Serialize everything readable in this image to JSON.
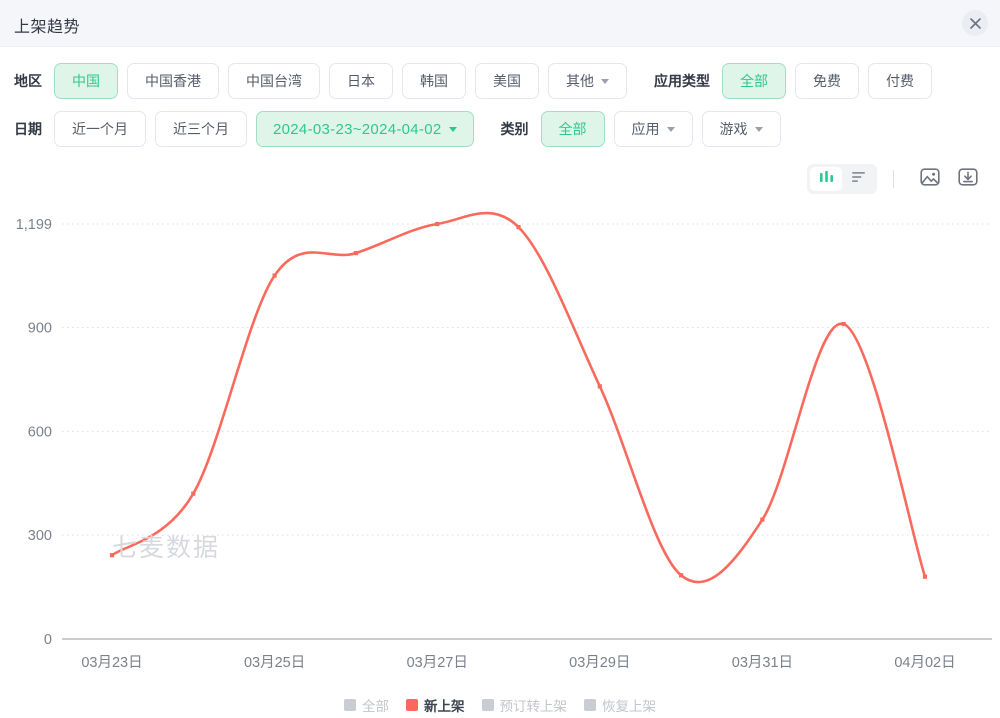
{
  "header": {
    "title": "上架趋势",
    "close_icon": "close-icon"
  },
  "filters": {
    "region": {
      "label": "地区",
      "options": [
        {
          "label": "中国",
          "active": true,
          "caret": false
        },
        {
          "label": "中国香港",
          "active": false,
          "caret": false
        },
        {
          "label": "中国台湾",
          "active": false,
          "caret": false
        },
        {
          "label": "日本",
          "active": false,
          "caret": false
        },
        {
          "label": "韩国",
          "active": false,
          "caret": false
        },
        {
          "label": "美国",
          "active": false,
          "caret": false
        },
        {
          "label": "其他",
          "active": false,
          "caret": true
        }
      ]
    },
    "app_type": {
      "label": "应用类型",
      "options": [
        {
          "label": "全部",
          "active": true,
          "caret": false
        },
        {
          "label": "免费",
          "active": false,
          "caret": false
        },
        {
          "label": "付费",
          "active": false,
          "caret": false
        }
      ]
    },
    "date": {
      "label": "日期",
      "options": [
        {
          "label": "近一个月",
          "active": false,
          "caret": false
        },
        {
          "label": "近三个月",
          "active": false,
          "caret": false
        },
        {
          "label": "2024-03-23~2024-04-02",
          "active": true,
          "caret": true
        }
      ]
    },
    "category": {
      "label": "类别",
      "options": [
        {
          "label": "全部",
          "active": true,
          "caret": false
        },
        {
          "label": "应用",
          "active": false,
          "caret": true
        },
        {
          "label": "游戏",
          "active": false,
          "caret": true
        }
      ]
    }
  },
  "toolbar": {
    "chart_view_icon": "bar-chart-icon",
    "table_view_icon": "list-view-icon",
    "image_export_icon": "image-export-icon",
    "download_icon": "download-icon",
    "selected_view": "chart"
  },
  "chart": {
    "watermark": "七麦数据",
    "accent_color": "#f96a5d",
    "grid_color": "#dcdee3",
    "axis_color": "#b8bcc6",
    "tick_label_color": "#7b818c"
  },
  "chart_data": {
    "type": "line",
    "title": "上架趋势",
    "xlabel": "",
    "ylabel": "",
    "grid": true,
    "legend_position": "bottom",
    "ylim": [
      0,
      1199
    ],
    "yticks": [
      0,
      300,
      600,
      900,
      1199
    ],
    "ytick_labels": [
      "0",
      "300",
      "600",
      "900",
      "1,199"
    ],
    "x": [
      "03月23日",
      "03月24日",
      "03月25日",
      "03月26日",
      "03月27日",
      "03月28日",
      "03月29日",
      "03月30日",
      "03月31日",
      "04月01日",
      "04月02日"
    ],
    "xtick_labels": [
      "03月23日",
      "03月25日",
      "03月27日",
      "03月29日",
      "03月31日",
      "04月02日"
    ],
    "xtick_indices": [
      0,
      2,
      4,
      6,
      8,
      10
    ],
    "series": [
      {
        "name": "全部",
        "color": "#c9ccd2",
        "active": false,
        "values": []
      },
      {
        "name": "新上架",
        "color": "#f96a5d",
        "active": true,
        "values": [
          242,
          420,
          1050,
          1115,
          1199,
          1190,
          730,
          184,
          345,
          910,
          180
        ]
      },
      {
        "name": "预订转上架",
        "color": "#c9ccd2",
        "active": false,
        "values": []
      },
      {
        "name": "恢复上架",
        "color": "#c9ccd2",
        "active": false,
        "values": []
      }
    ]
  },
  "legend": [
    {
      "label": "全部",
      "active": false
    },
    {
      "label": "新上架",
      "active": true
    },
    {
      "label": "预订转上架",
      "active": false
    },
    {
      "label": "恢复上架",
      "active": false
    }
  ]
}
